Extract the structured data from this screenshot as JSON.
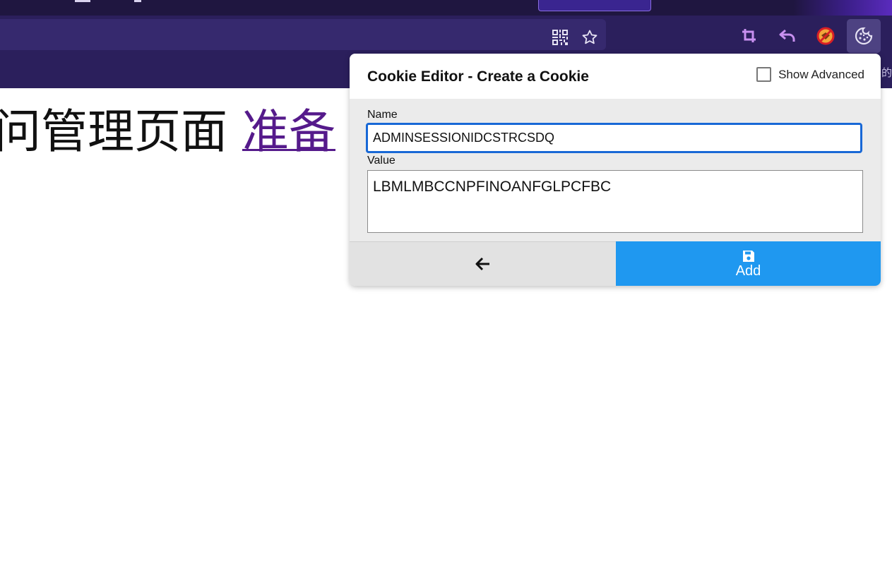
{
  "browser": {
    "bookmark_fragment": "的"
  },
  "page": {
    "heading_text": "问管理页面 ",
    "heading_link": "准备"
  },
  "popup": {
    "title": "Cookie Editor - Create a Cookie",
    "show_advanced_label": "Show Advanced",
    "show_advanced_checked": false,
    "name_label": "Name",
    "name_value": "ADMINSESSIONIDCSTRCSDQ",
    "value_label": "Value",
    "value_value": "LBMLMBCCNPFINOANFGLPCFBC",
    "add_label": "Add"
  },
  "icons": {
    "qr": "qr-code-icon",
    "bookmark": "star-icon",
    "crop": "crop-icon",
    "undo": "undo-arrow-icon",
    "blocked": "blocked-extension-icon",
    "cookie": "cookie-icon",
    "back": "arrow-left-icon",
    "save": "floppy-disk-icon"
  },
  "colors": {
    "toolbar": "#2b1f5c",
    "tabstrip": "#1f1640",
    "accent_add": "#1f98f0",
    "focus_border": "#1868d6",
    "link": "#551a8b"
  }
}
